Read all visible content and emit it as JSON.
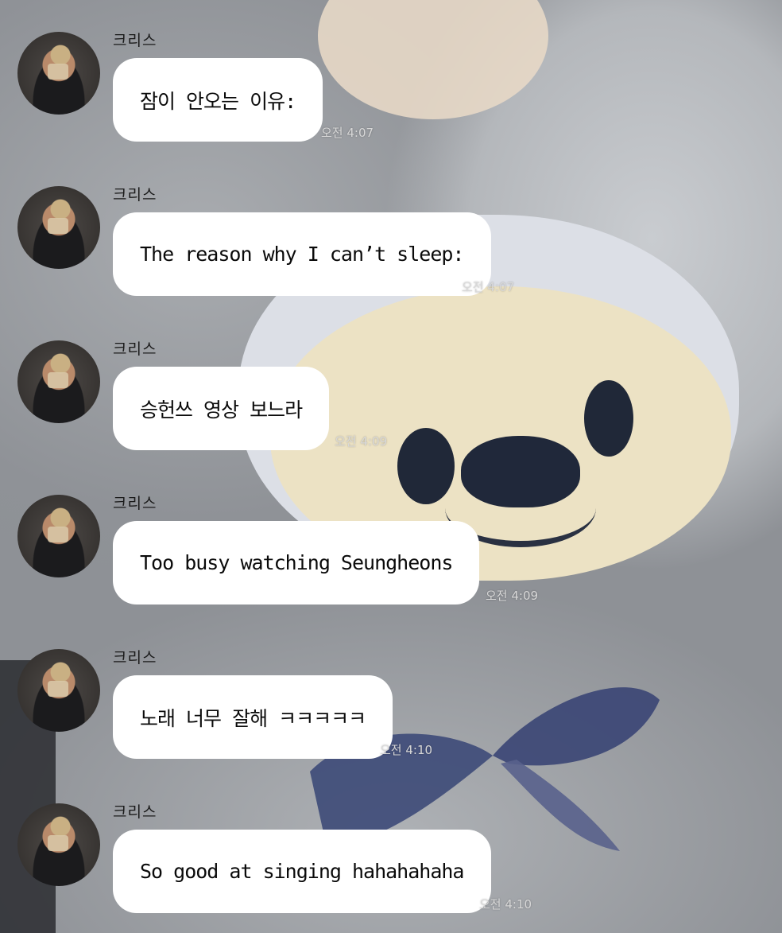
{
  "messages": [
    {
      "sender": "크리스",
      "text": "잠이 안오는 이유:",
      "time": "오전 4:07"
    },
    {
      "sender": "크리스",
      "text": "The reason why I can’t sleep:",
      "time": "오전 4:07"
    },
    {
      "sender": "크리스",
      "text": "승헌쓰 영상 보느라",
      "time": "오전 4:09"
    },
    {
      "sender": "크리스",
      "text": "Too busy watching Seungheons",
      "time": "오전 4:09"
    },
    {
      "sender": "크리스",
      "text": "노래 너무 잘해 ㅋㅋㅋㅋㅋ",
      "time": "오전 4:10"
    },
    {
      "sender": "크리스",
      "text": "So good at singing hahahahaha",
      "time": "오전 4:10"
    }
  ],
  "colors": {
    "bubble": "#ffffff",
    "text": "#0a0a0a",
    "time": "#d8d8d8"
  }
}
